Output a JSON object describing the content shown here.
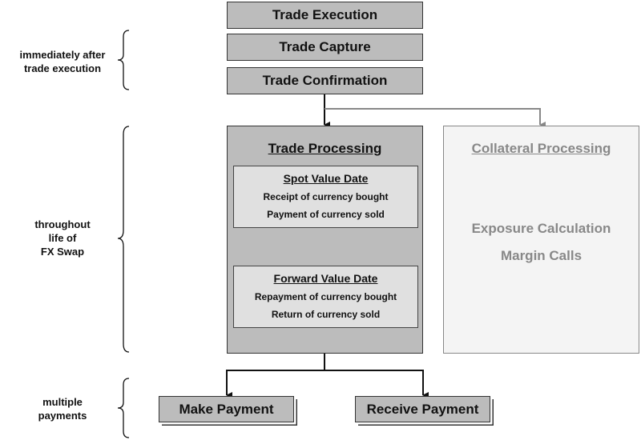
{
  "colors": {
    "box_fill": "#bcbcbc",
    "sub_fill": "#e0e0e0",
    "collateral_fill": "#f4f4f4",
    "collateral_text": "#888888"
  },
  "steps": [
    "Trade Execution",
    "Trade Capture",
    "Trade Confirmation"
  ],
  "phase_labels": {
    "immediate": "immediately after trade execution",
    "life_lines": [
      "throughout",
      "life of",
      "FX Swap"
    ],
    "payments_lines": [
      "multiple",
      "payments"
    ],
    "immediate_lines": [
      "immediately after",
      "trade execution"
    ]
  },
  "trade_processing": {
    "title": "Trade Processing",
    "spot": {
      "title": "Spot Value Date",
      "lines": [
        "Receipt of currency bought",
        "Payment of currency sold"
      ]
    },
    "forward": {
      "title": "Forward Value Date",
      "lines": [
        "Repayment of currency bought",
        "Return of currency sold"
      ]
    }
  },
  "collateral": {
    "title": "Collateral Processing",
    "lines": [
      "Exposure Calculation",
      "Margin Calls"
    ]
  },
  "payments": [
    "Make Payment",
    "Receive Payment"
  ]
}
